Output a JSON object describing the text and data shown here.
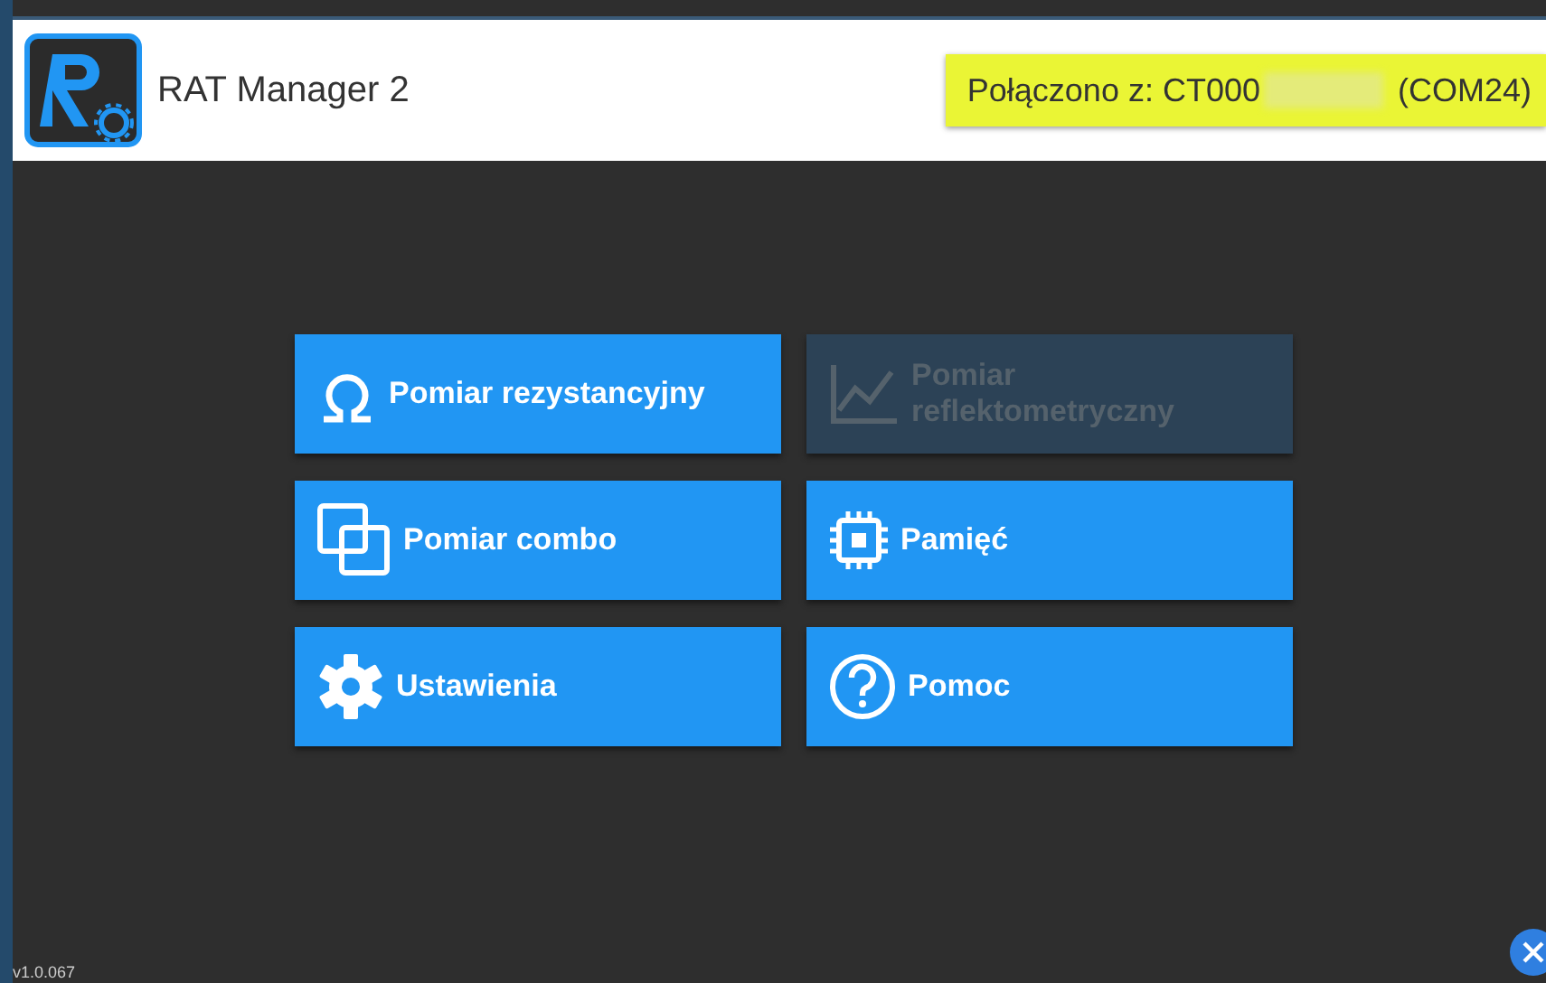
{
  "header": {
    "title": "RAT Manager 2",
    "connection": {
      "prefix": "Połączono z: CT000",
      "port": "(COM24)"
    }
  },
  "menu": [
    {
      "label": "Pomiar rezystancyjny",
      "kind": "omega",
      "disabled": false
    },
    {
      "label": "Pomiar reflektometryczny",
      "kind": "chart",
      "disabled": true
    },
    {
      "label": "Pomiar combo",
      "kind": "squares",
      "disabled": false
    },
    {
      "label": "Pamięć",
      "kind": "chip",
      "disabled": false
    },
    {
      "label": "Ustawienia",
      "kind": "gear",
      "disabled": false
    },
    {
      "label": "Pomoc",
      "kind": "help",
      "disabled": false
    }
  ],
  "version": "v1.0.067"
}
